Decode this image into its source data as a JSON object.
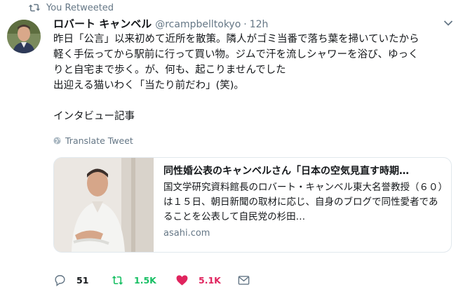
{
  "retweet_bar": {
    "label": "You Retweeted"
  },
  "tweet": {
    "author_name": "ロバート キャンベル",
    "handle": "@rcampbelltokyo",
    "separator": "·",
    "time": "12h",
    "text_lines": [
      "昨日「公言」以来初めて近所を散策。隣人がゴミ当番で落ち葉を掃いていたから",
      "軽く手伝ってから駅前に行って買い物。ジムで汗を流しシャワーを浴び、ゆっく",
      "りと自宅まで歩く。が、何も、起こりませんでした",
      "出迎える猫いわく「当たり前だわ」(笑)。",
      "",
      "インタビュー記事"
    ],
    "translate_label": "Translate Tweet"
  },
  "card": {
    "title": "同性婚公表のキャンベルさん「日本の空気見直す時期…",
    "description": "国文学研究資料館長のロバート・キャンベル東大名誉教授（６０）は１５日、朝日新聞の取材に応じ、自身のブログで同性愛者であることを公表して自民党の杉田…",
    "domain": "asahi.com"
  },
  "actions": {
    "reply_count": "51",
    "retweet_count": "1.5K",
    "like_count": "5.1K"
  },
  "colors": {
    "secondary_text": "#657786",
    "retweet_green": "#17bf63",
    "like_red": "#e0245e",
    "border": "#e1e8ed"
  },
  "icons": [
    "retweet-icon",
    "avatar",
    "chevron-down-icon",
    "globe-icon",
    "reply-icon",
    "retweet-icon",
    "heart-icon",
    "mail-icon"
  ]
}
